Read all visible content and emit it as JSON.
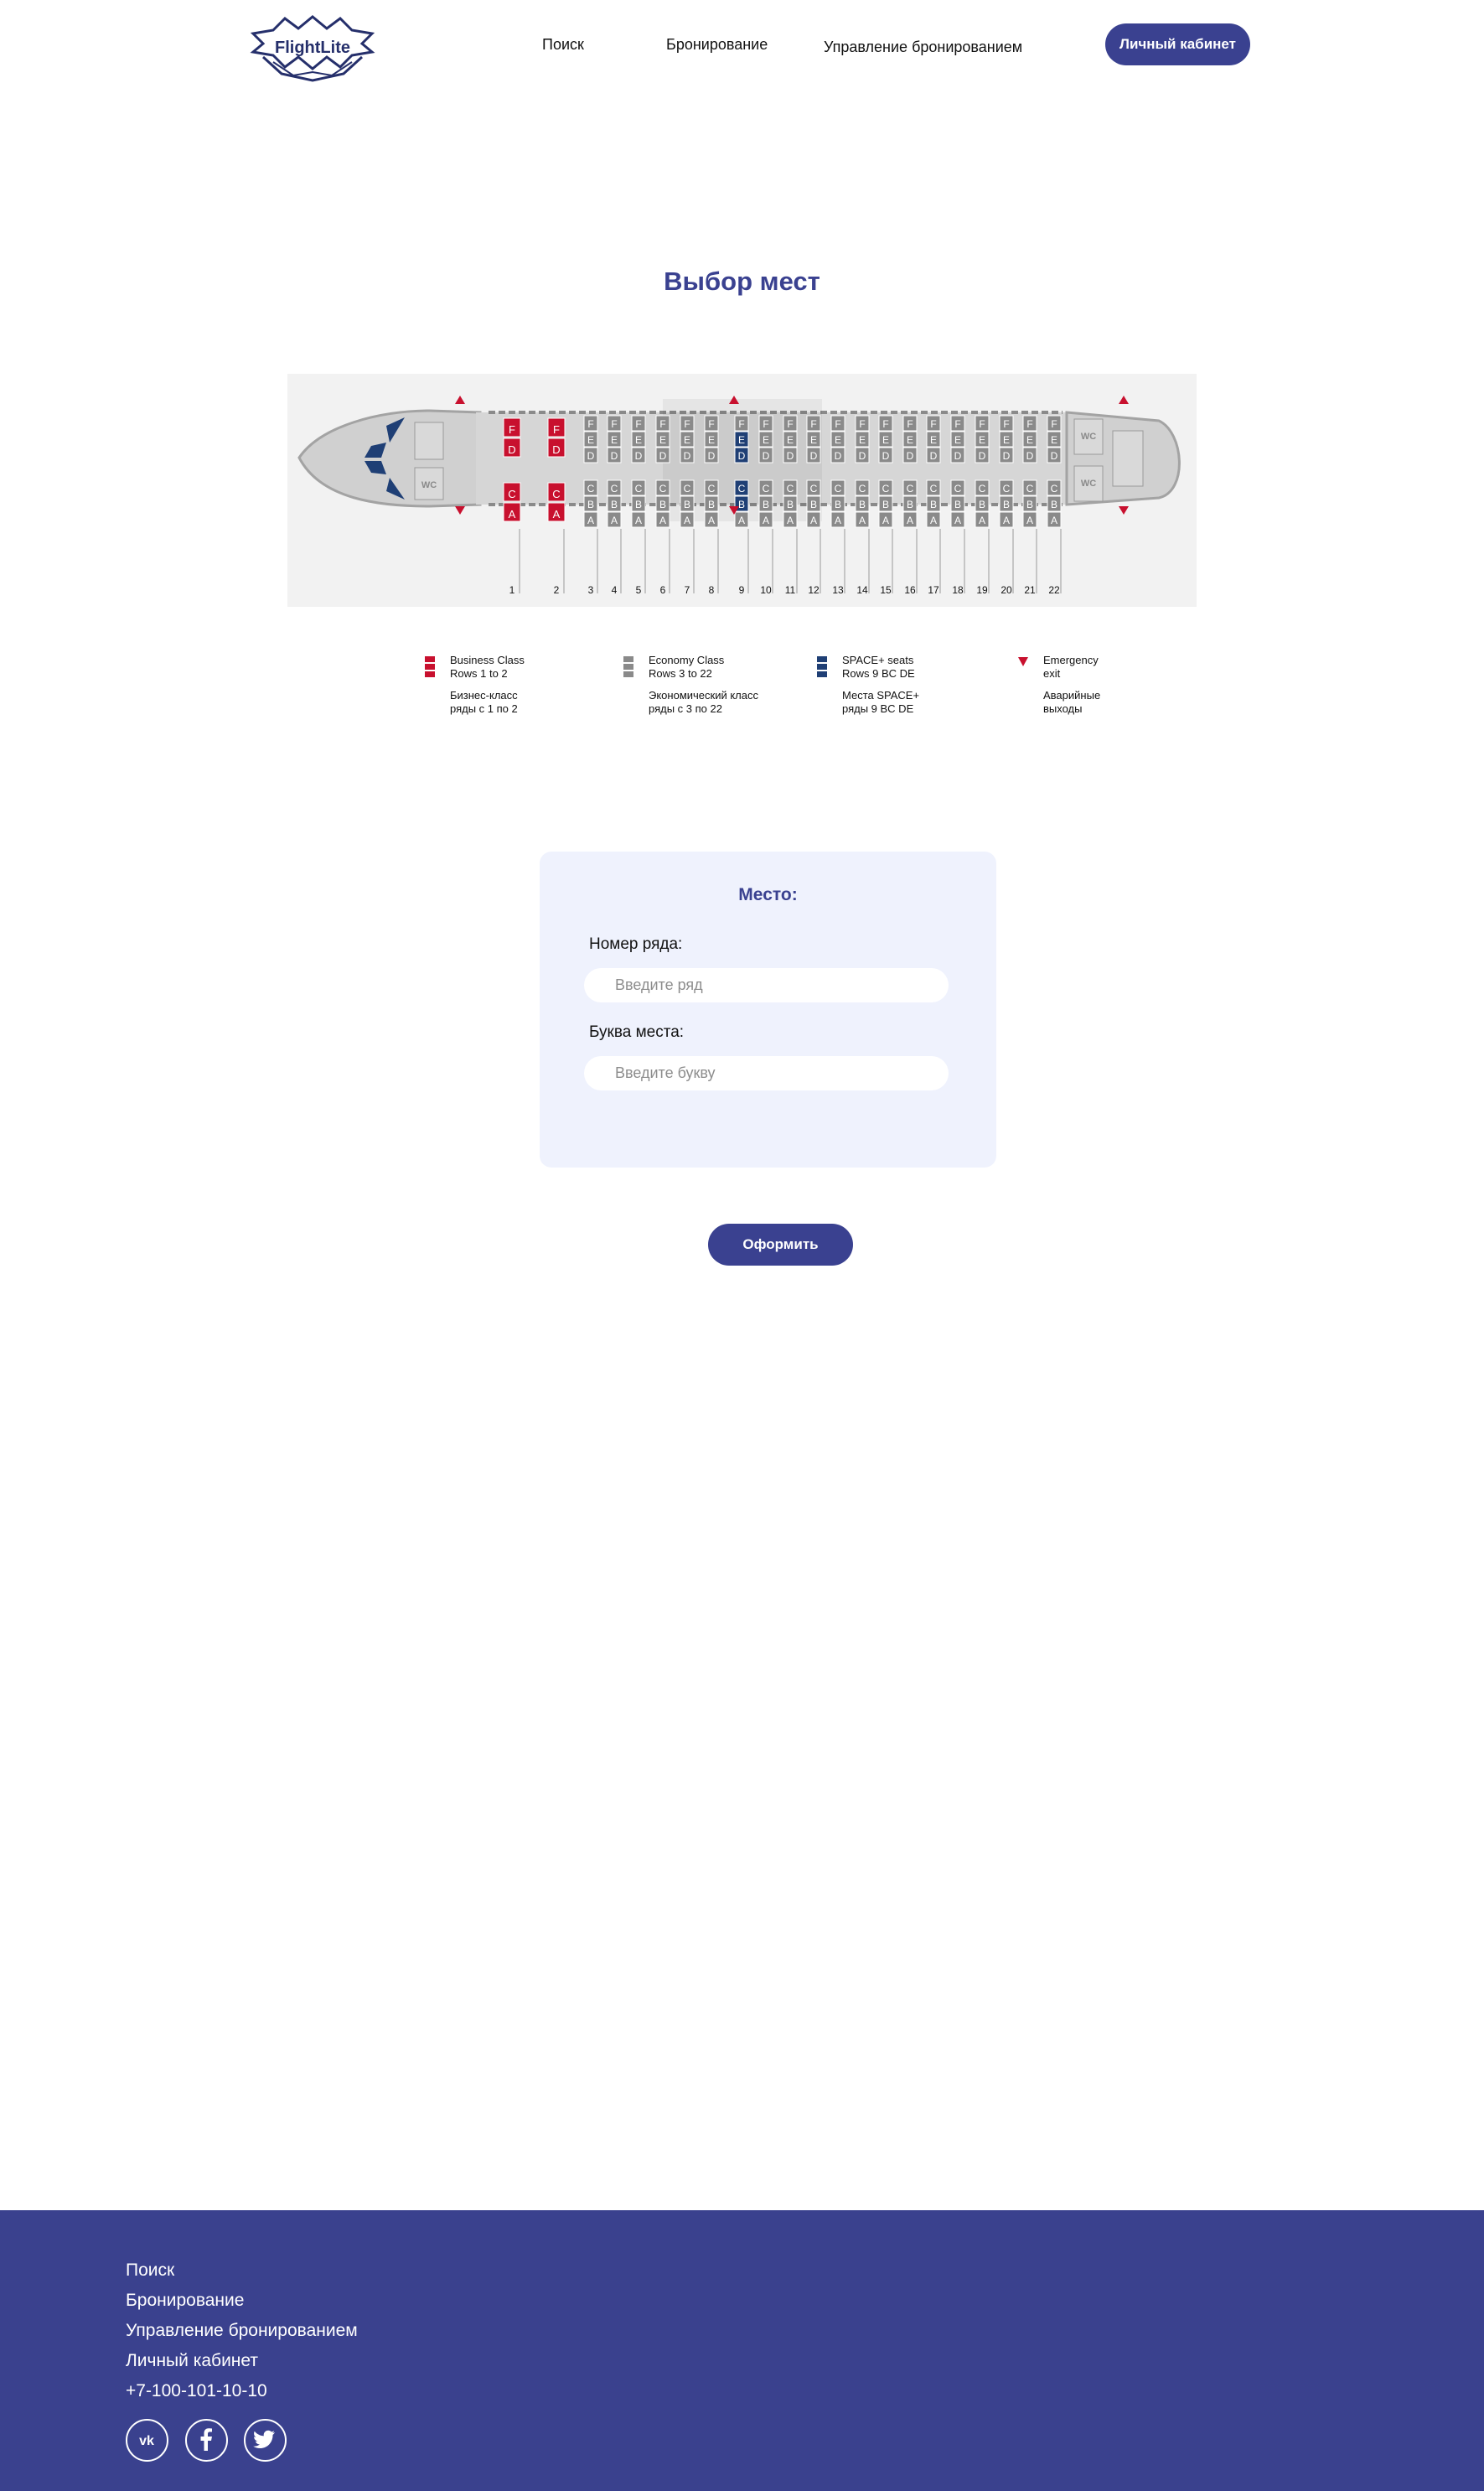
{
  "header": {
    "logo_text": "FlightLite",
    "nav": {
      "search": "Поиск",
      "booking": "Бронирование",
      "manage": "Управление бронированием"
    },
    "cabinet_button": "Личный кабинет"
  },
  "page_title": "Выбор мест",
  "seatmap": {
    "rows": [
      "1",
      "2",
      "3",
      "4",
      "5",
      "6",
      "7",
      "8",
      "9",
      "10",
      "11",
      "12",
      "13",
      "14",
      "15",
      "16",
      "17",
      "18",
      "19",
      "20",
      "21",
      "22"
    ],
    "business_letters_top": [
      "F",
      "D"
    ],
    "business_letters_bottom": [
      "C",
      "A"
    ],
    "economy_letters_top": [
      "F",
      "E",
      "D"
    ],
    "economy_letters_bottom": [
      "C",
      "B",
      "A"
    ],
    "wc_label": "WC",
    "colors": {
      "business": "#c8102e",
      "economy": "#8a8a8a",
      "space_plus": "#1f3f75",
      "exit": "#c8102e"
    }
  },
  "legend": [
    {
      "en_1": "Business Class",
      "en_2": "Rows 1 to 2",
      "ru_1": "Бизнес-класс",
      "ru_2": "ряды с 1 по 2"
    },
    {
      "en_1": "Economy Class",
      "en_2": "Rows 3 to 22",
      "ru_1": "Экономический класс",
      "ru_2": "ряды с 3 по 22"
    },
    {
      "en_1": "SPACE+ seats",
      "en_2": "Rows 9 BC DE",
      "ru_1": "Места SPACE+",
      "ru_2": "ряды 9 BC DE"
    },
    {
      "en_1": "Emergency",
      "en_2": "exit",
      "ru_1": "Аварийные",
      "ru_2": "выходы"
    }
  ],
  "seat_form": {
    "title": "Место:",
    "row_label": "Номер ряда:",
    "row_placeholder": "Введите ряд",
    "letter_label": "Буква места:",
    "letter_placeholder": "Введите букву"
  },
  "submit_button": "Оформить",
  "footer": {
    "links": [
      "Поиск",
      "Бронирование",
      "Управление бронированием",
      "Личный кабинет"
    ],
    "phone": "+7-100-101-10-10"
  }
}
